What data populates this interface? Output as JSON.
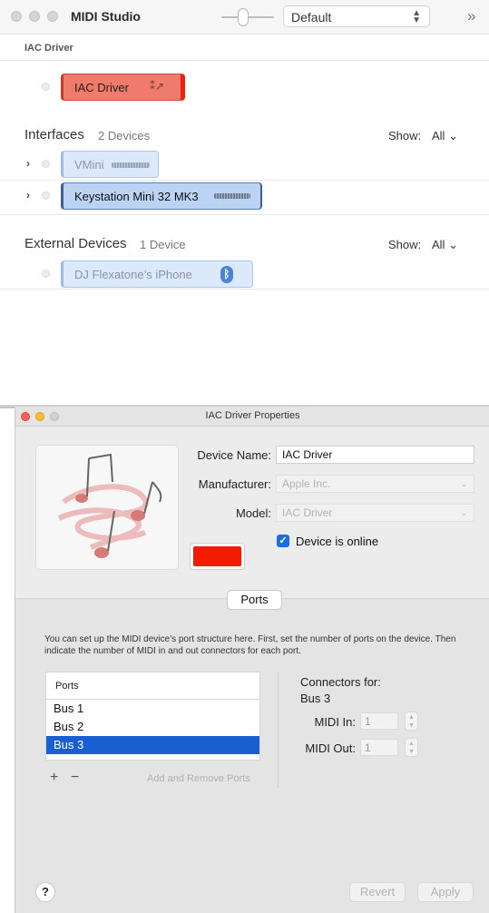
{
  "studio": {
    "title": "MIDI Studio",
    "configuration": "Default",
    "iac_section_label": "IAC Driver",
    "iac_device": "IAC Driver",
    "interfaces": {
      "title": "Interfaces",
      "count": "2 Devices",
      "show_label": "Show:",
      "show_value": "All",
      "devices": [
        "VMini",
        "Keystation Mini 32 MK3"
      ]
    },
    "external": {
      "title": "External Devices",
      "count": "1 Device",
      "show_label": "Show:",
      "show_value": "All",
      "devices": [
        "DJ Flexatone’s iPhone"
      ]
    }
  },
  "props": {
    "title": "IAC Driver Properties",
    "device_name_label": "Device Name:",
    "device_name_value": "IAC Driver",
    "manufacturer_label": "Manufacturer:",
    "manufacturer_placeholder": "Apple Inc.",
    "model_label": "Model:",
    "model_placeholder": "IAC Driver",
    "online_label": "Device is online",
    "online_checked": true,
    "device_color": "#f31c00",
    "ports_tab": "Ports",
    "description": "You can set up the MIDI device’s port structure here. First, set the number of ports on the device. Then indicate the number of MIDI in and out connectors for each port.",
    "ports_header": "Ports",
    "ports": [
      "Bus 1",
      "Bus 2",
      "Bus 3"
    ],
    "selected_port": "Bus 3",
    "add_remove_label": "Add and Remove Ports",
    "connectors_for_label": "Connectors for:",
    "connectors_for_value": "Bus 3",
    "midi_in_label": "MIDI In:",
    "midi_in_value": "1",
    "midi_out_label": "MIDI Out:",
    "midi_out_value": "1",
    "help": "?",
    "revert": "Revert",
    "apply": "Apply"
  },
  "icons": {
    "chevron_right": "›",
    "chevron_down": "⌄",
    "more": "»",
    "bluetooth": "ᛒ",
    "plus": "+",
    "minus": "−",
    "check": "✓"
  },
  "colors": {
    "iac_red": "#e8230e",
    "selection_blue": "#1a5fd1",
    "checkbox_blue": "#1d6de2"
  }
}
